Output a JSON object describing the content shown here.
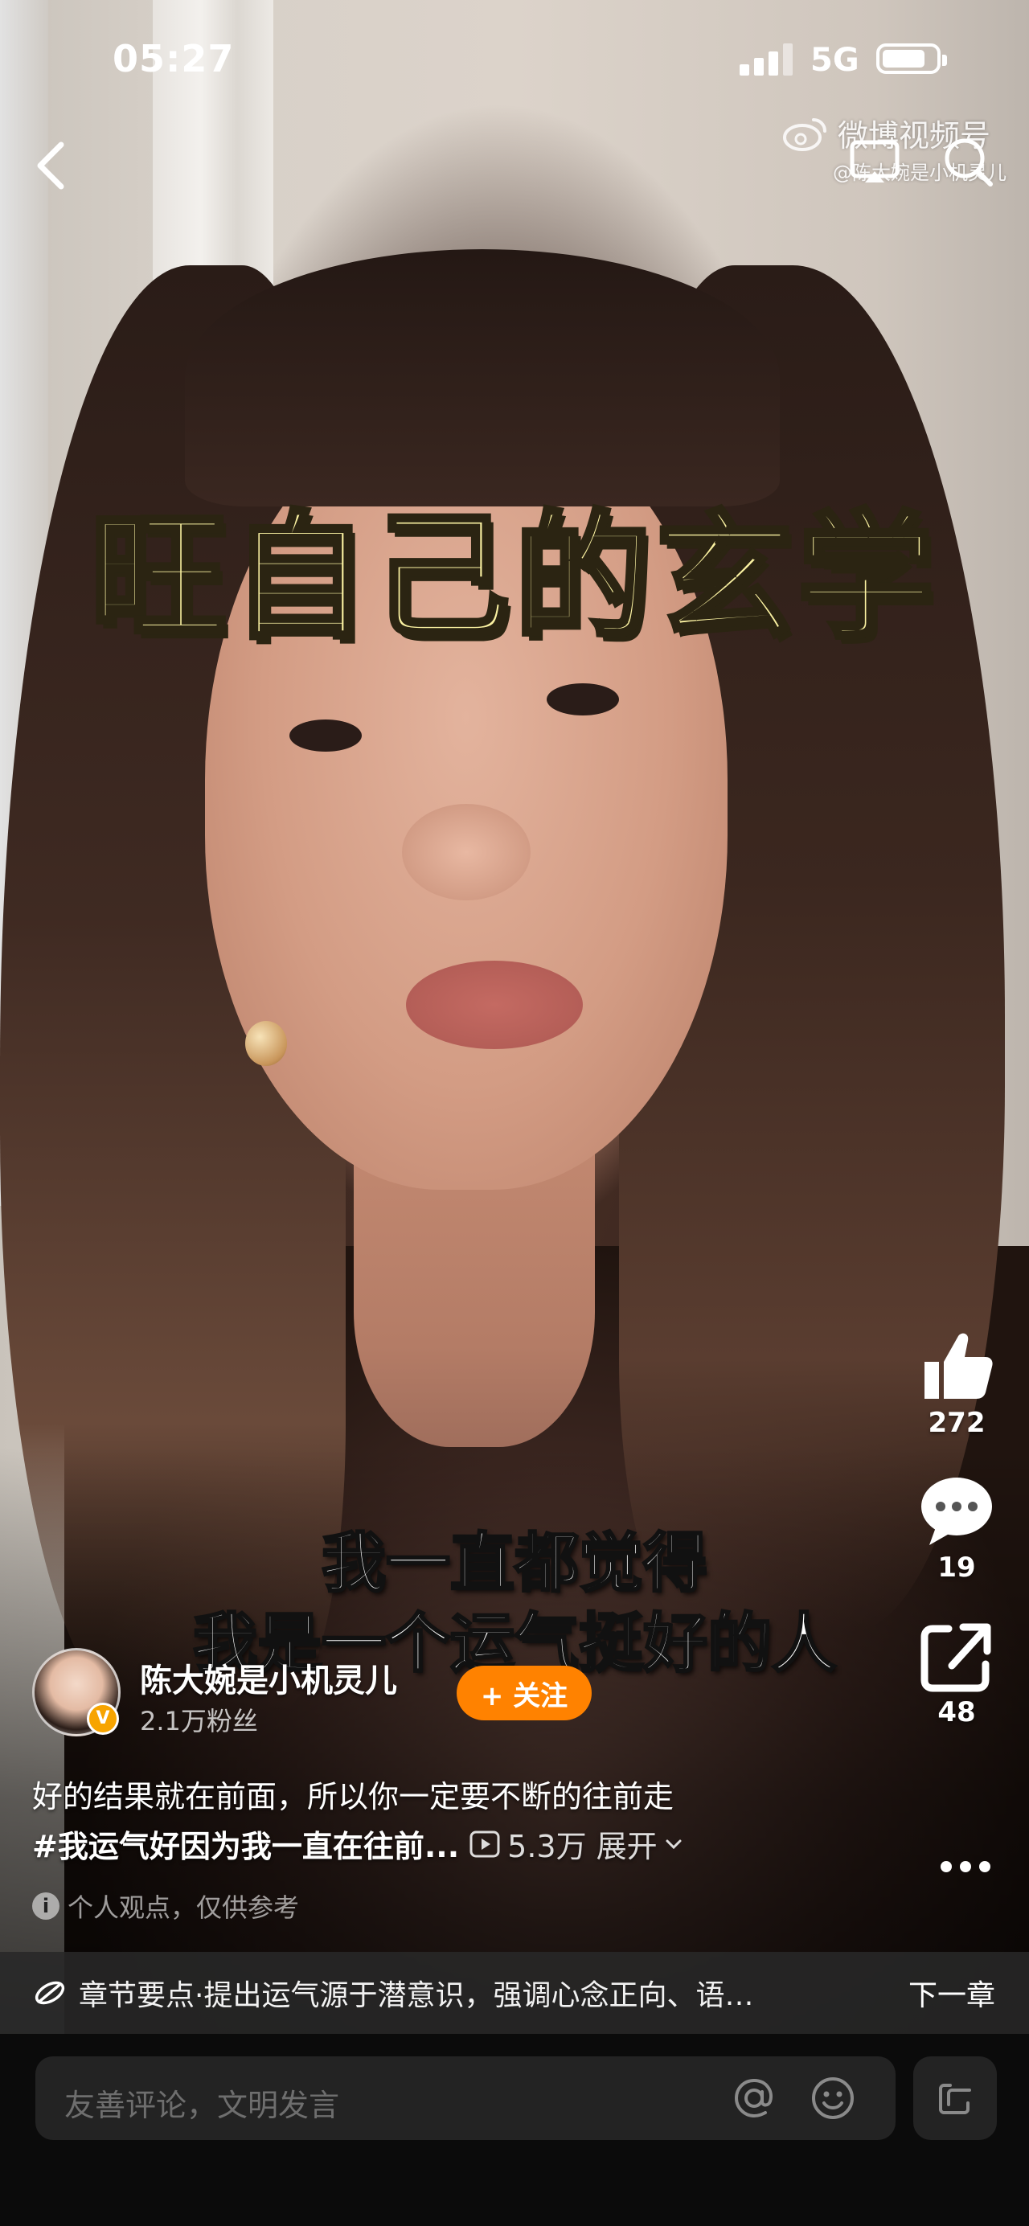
{
  "status_bar": {
    "time": "05:27",
    "network": "5G"
  },
  "watermark": {
    "brand": "微博视频号",
    "author": "@陈大婉是小机灵儿"
  },
  "video": {
    "title_overlay": "旺自己的玄学",
    "subtitle_line1": "我一直都觉得",
    "subtitle_line2": "我是一个运气挺好的人"
  },
  "actions": {
    "like_count": "272",
    "comment_count": "19",
    "share_count": "48"
  },
  "author": {
    "name": "陈大婉是小机灵儿",
    "fans": "2.1万粉丝",
    "follow_label": "+ 关注",
    "verified_badge": "V"
  },
  "post": {
    "description": "好的结果就在前面，所以你一定要不断的往前走",
    "hashtag": "#我运气好因为我一直在往前...",
    "views": "5.3万",
    "expand_label": "展开",
    "notice": "个人观点，仅供参考",
    "notice_icon": "i"
  },
  "chapter": {
    "text": "章节要点·提出运气源于潜意识，强调心念正向、语…",
    "next_label": "下一章"
  },
  "comment": {
    "placeholder": "友善评论，文明发言"
  },
  "colors": {
    "follow": "#ff8200",
    "title_fill": "#fbf2a2",
    "badge": "#f7a400"
  }
}
